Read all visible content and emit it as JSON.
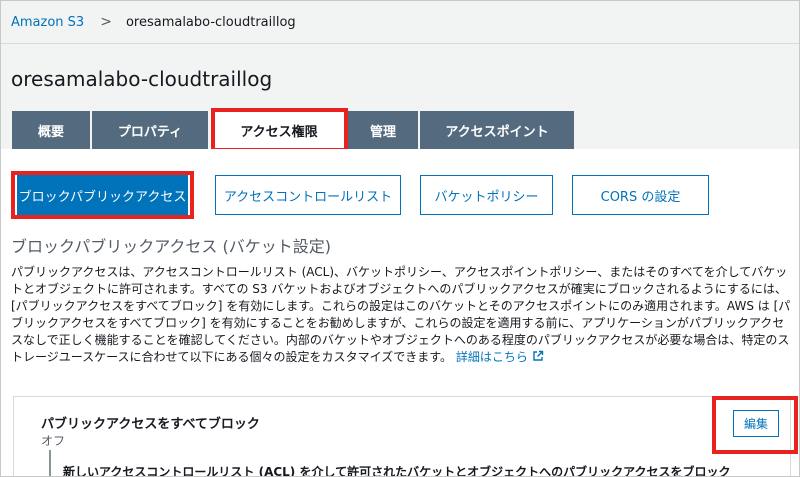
{
  "breadcrumb": {
    "root": "Amazon S3",
    "separator": ">",
    "current": "oresamalabo-cloudtraillog"
  },
  "page": {
    "title": "oresamalabo-cloudtraillog"
  },
  "tabs": [
    {
      "label": "概要",
      "active": false
    },
    {
      "label": "プロパティ",
      "active": false
    },
    {
      "label": "アクセス権限",
      "active": true
    },
    {
      "label": "管理",
      "active": false
    },
    {
      "label": "アクセスポイント",
      "active": false
    }
  ],
  "subtabs": [
    {
      "label": "ブロックパブリックアクセス",
      "active": true
    },
    {
      "label": "アクセスコントロールリスト",
      "active": false
    },
    {
      "label": "バケットポリシー",
      "active": false
    },
    {
      "label": "CORS の設定",
      "active": false
    }
  ],
  "section": {
    "title": "ブロックパブリックアクセス (バケット設定)",
    "description": "パブリックアクセスは、アクセスコントロールリスト (ACL)、バケットポリシー、アクセスポイントポリシー、またはそのすべてを介してバケットとオブジェクトに許可されます。すべての S3 バケットおよびオブジェクトへのパブリックアクセスが確実にブロックされるようにするには、[パブリックアクセスをすべてブロック] を有効にします。これらの設定はこのバケットとそのアクセスポイントにのみ適用されます。AWS は [パブリックアクセスをすべてブロック] を有効にすることをお勧めしますが、これらの設定を適用する前に、アプリケーションがパブリックアクセスなしで正しく機能することを確認してください。内部のバケットやオブジェクトへのある程度のパブリックアクセスが必要な場合は、特定のストレージユースケースに合わせて以下にある個々の設定をカスタマイズできます。",
    "learn_more": "詳細はこちら"
  },
  "settings": {
    "block_all_title": "パブリックアクセスをすべてブロック",
    "block_all_status": "オフ",
    "edit_label": "編集",
    "sub_item": "新しいアクセスコントロールリスト (ACL) を介して許可されたバケットとオブジェクトへのパブリックアクセスをブロック"
  },
  "colors": {
    "accent": "#0073bb",
    "tab_bg": "#546b7f",
    "highlight": "#e8231f",
    "page_bg": "#f2f3f3"
  },
  "icons": {
    "breadcrumb_separator": "chevron-right-icon",
    "external_link": "external-link-icon"
  }
}
